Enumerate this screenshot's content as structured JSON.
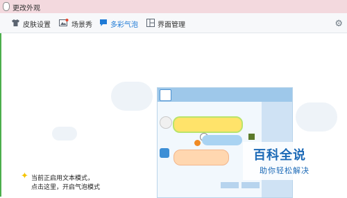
{
  "window": {
    "title": "更改外观"
  },
  "tabs": [
    {
      "label": "皮肤设置",
      "icon": "shirt-icon",
      "active": false
    },
    {
      "label": "场景秀",
      "icon": "picture-icon",
      "active": false
    },
    {
      "label": "多彩气泡",
      "icon": "speech-bubble-icon",
      "active": true
    },
    {
      "label": "界面管理",
      "icon": "layout-icon",
      "active": false
    }
  ],
  "settings_icon": "gear-icon",
  "hint": {
    "line1": "当前正启用文本模式，",
    "line2": "点击这里，开启气泡模式"
  },
  "watermark": {
    "title": "百科全说",
    "subtitle": "助你轻松解决"
  },
  "colors": {
    "accent": "#1e7ad6",
    "titlebar": "#f3d9de",
    "watermark": "#1b69b6"
  }
}
